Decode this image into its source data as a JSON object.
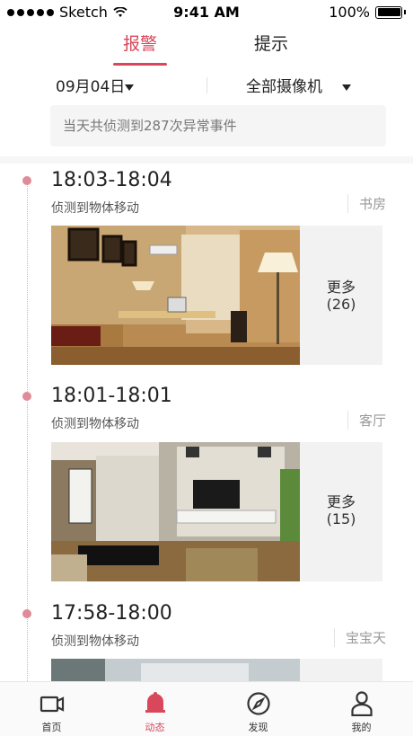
{
  "status_bar": {
    "carrier": "Sketch",
    "time": "9:41 AM",
    "battery": "100%"
  },
  "top_tabs": [
    {
      "label": "报警",
      "active": true
    },
    {
      "label": "提示",
      "active": false
    }
  ],
  "filters": {
    "date": "09月04日",
    "camera": "全部摄像机"
  },
  "summary_text": "当天共侦测到287次异常事件",
  "events": [
    {
      "time": "18:03-18:04",
      "description": "侦测到物体移动",
      "location": "书房",
      "more_label": "更多",
      "more_count": "(26)"
    },
    {
      "time": "18:01-18:01",
      "description": "侦测到物体移动",
      "location": "客厅",
      "more_label": "更多",
      "more_count": "(15)"
    },
    {
      "time": "17:58-18:00",
      "description": "侦测到物体移动",
      "location": "宝宝天"
    }
  ],
  "bottom_nav": [
    {
      "label": "首页",
      "icon": "camera-icon",
      "active": false
    },
    {
      "label": "动态",
      "icon": "bell-icon",
      "active": true
    },
    {
      "label": "发现",
      "icon": "compass-icon",
      "active": false
    },
    {
      "label": "我的",
      "icon": "person-icon",
      "active": false
    }
  ],
  "colors": {
    "accent": "#d8475a",
    "timeline_dot": "#e08b98"
  }
}
